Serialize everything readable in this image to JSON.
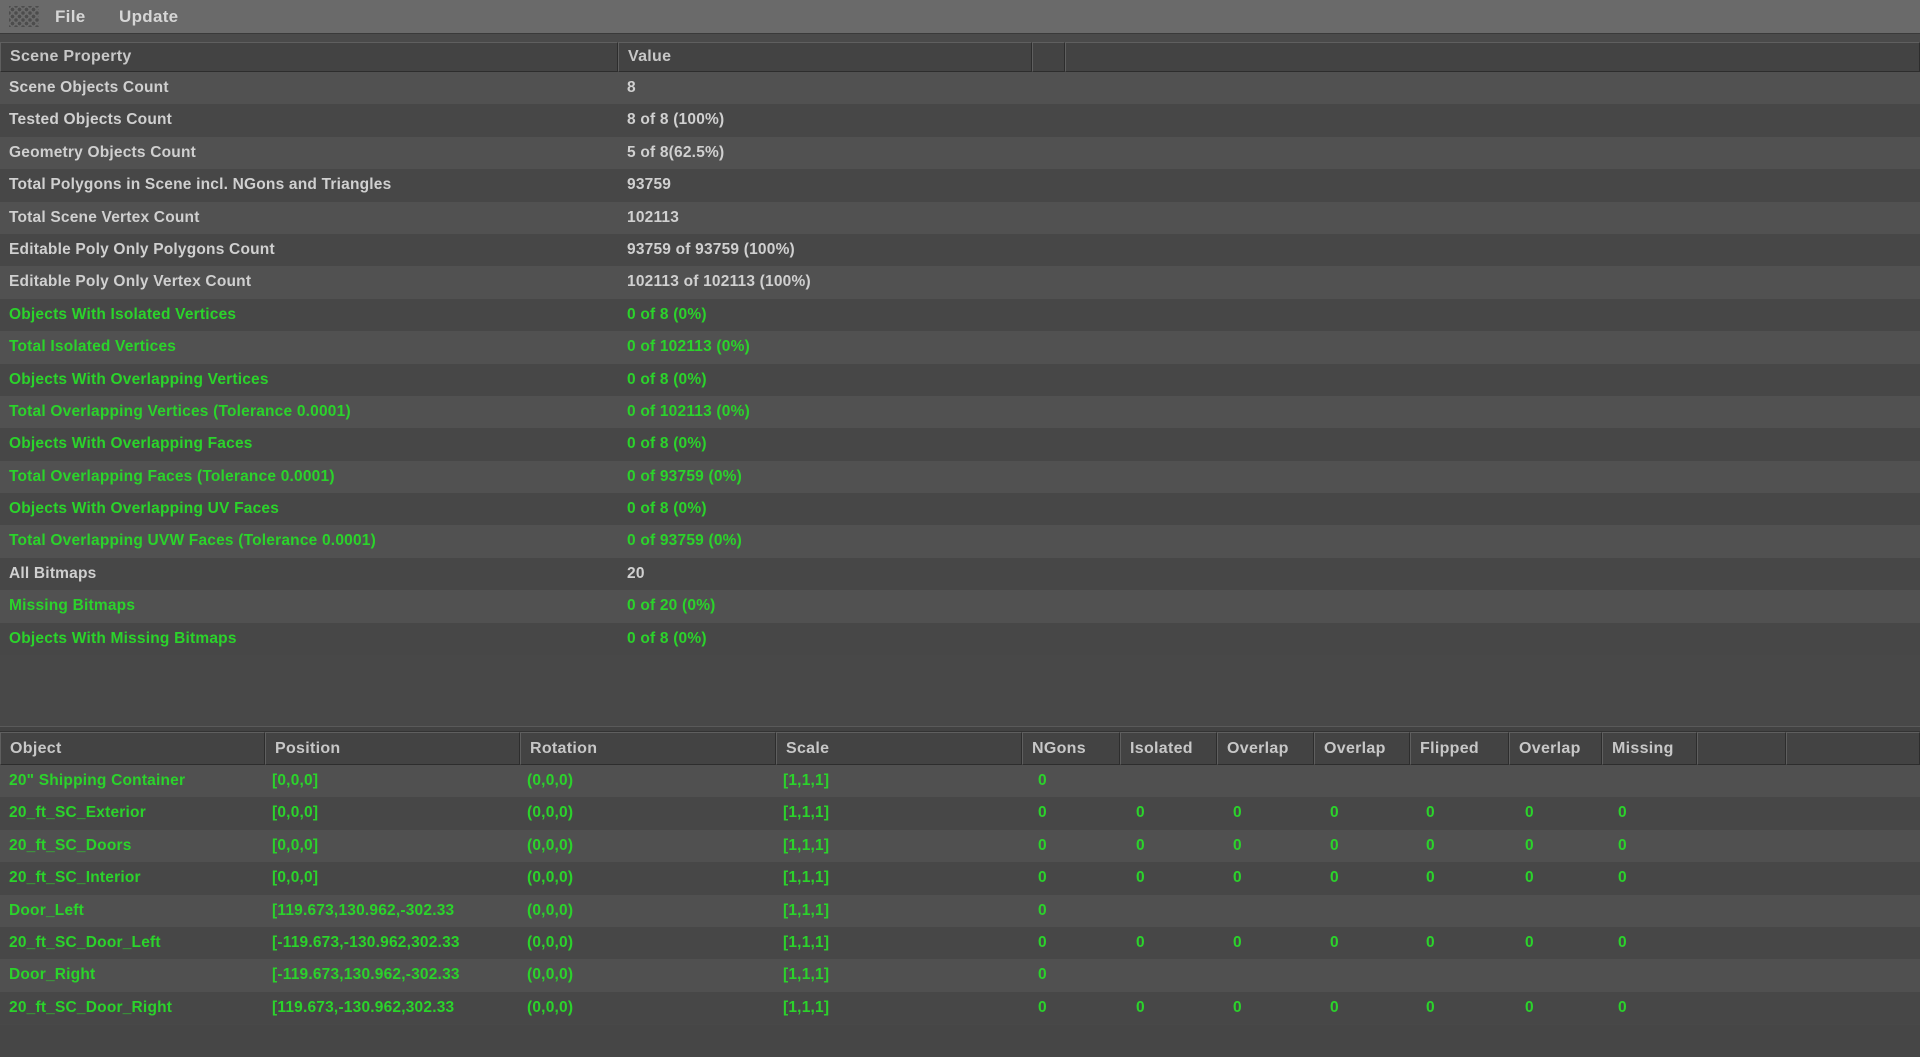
{
  "menu": {
    "file_label": "File",
    "update_label": "Update"
  },
  "scene_table": {
    "headers": {
      "property": "Scene Property",
      "value": "Value"
    },
    "rows": [
      {
        "property": "Scene Objects Count",
        "value": "8",
        "highlight": false
      },
      {
        "property": "Tested Objects Count",
        "value": "8 of 8 (100%)",
        "highlight": false
      },
      {
        "property": "Geometry Objects Count",
        "value": "5 of 8(62.5%)",
        "highlight": false
      },
      {
        "property": "Total Polygons in Scene incl. NGons and Triangles",
        "value": "93759",
        "highlight": false
      },
      {
        "property": "Total Scene Vertex Count",
        "value": "102113",
        "highlight": false
      },
      {
        "property": "Editable Poly Only Polygons Count",
        "value": "93759 of 93759 (100%)",
        "highlight": false
      },
      {
        "property": "Editable Poly Only Vertex Count",
        "value": "102113 of 102113 (100%)",
        "highlight": false
      },
      {
        "property": "Objects With Isolated Vertices",
        "value": "0 of 8 (0%)",
        "highlight": true
      },
      {
        "property": "Total Isolated Vertices",
        "value": "0 of 102113 (0%)",
        "highlight": true
      },
      {
        "property": "Objects With Overlapping Vertices",
        "value": "0 of 8 (0%)",
        "highlight": true
      },
      {
        "property": "Total Overlapping Vertices (Tolerance 0.0001)",
        "value": "0 of 102113 (0%)",
        "highlight": true
      },
      {
        "property": "Objects With Overlapping Faces",
        "value": "0 of 8 (0%)",
        "highlight": true
      },
      {
        "property": "Total Overlapping Faces (Tolerance 0.0001)",
        "value": "0 of 93759 (0%)",
        "highlight": true
      },
      {
        "property": "Objects With Overlapping UV Faces",
        "value": "0 of 8 (0%)",
        "highlight": true
      },
      {
        "property": "Total Overlapping UVW Faces (Tolerance 0.0001)",
        "value": "0 of 93759 (0%)",
        "highlight": true
      },
      {
        "property": "All Bitmaps",
        "value": "20",
        "highlight": false
      },
      {
        "property": "Missing Bitmaps",
        "value": "0 of 20 (0%)",
        "highlight": true
      },
      {
        "property": "Objects With Missing Bitmaps",
        "value": "0 of 8 (0%)",
        "highlight": true
      }
    ]
  },
  "objects_table": {
    "headers": [
      "Object",
      "Position",
      "Rotation",
      "Scale",
      "NGons",
      "Isolated",
      "Overlap",
      "Overlap",
      "Flipped",
      "Overlap",
      "Missing"
    ],
    "rows": [
      {
        "cells": [
          "20\" Shipping Container",
          "[0,0,0]",
          "(0,0,0)",
          "[1,1,1]",
          "0",
          "",
          "",
          "",
          "",
          "",
          ""
        ]
      },
      {
        "cells": [
          "20_ft_SC_Exterior",
          "[0,0,0]",
          "(0,0,0)",
          "[1,1,1]",
          "0",
          "0",
          "0",
          "0",
          "0",
          "0",
          "0"
        ]
      },
      {
        "cells": [
          "20_ft_SC_Doors",
          "[0,0,0]",
          "(0,0,0)",
          "[1,1,1]",
          "0",
          "0",
          "0",
          "0",
          "0",
          "0",
          "0"
        ]
      },
      {
        "cells": [
          "20_ft_SC_Interior",
          "[0,0,0]",
          "(0,0,0)",
          "[1,1,1]",
          "0",
          "0",
          "0",
          "0",
          "0",
          "0",
          "0"
        ]
      },
      {
        "cells": [
          "Door_Left",
          "[119.673,130.962,-302.33",
          "(0,0,0)",
          "[1,1,1]",
          "0",
          "",
          "",
          "",
          "",
          "",
          ""
        ]
      },
      {
        "cells": [
          "20_ft_SC_Door_Left",
          "[-119.673,-130.962,302.33",
          "(0,0,0)",
          "[1,1,1]",
          "0",
          "0",
          "0",
          "0",
          "0",
          "0",
          "0"
        ]
      },
      {
        "cells": [
          "Door_Right",
          "[-119.673,130.962,-302.33",
          "(0,0,0)",
          "[1,1,1]",
          "0",
          "",
          "",
          "",
          "",
          "",
          ""
        ]
      },
      {
        "cells": [
          "20_ft_SC_Door_Right",
          "[119.673,-130.962,302.33",
          "(0,0,0)",
          "[1,1,1]",
          "0",
          "0",
          "0",
          "0",
          "0",
          "0",
          "0"
        ]
      }
    ]
  },
  "colors": {
    "ok_green": "#2bd32b",
    "normal_text": "#d0d0d0",
    "menubar_bg": "#6a6a6a",
    "header_bg": "#434343",
    "row_light": "#515151",
    "row_dark": "#474747"
  }
}
